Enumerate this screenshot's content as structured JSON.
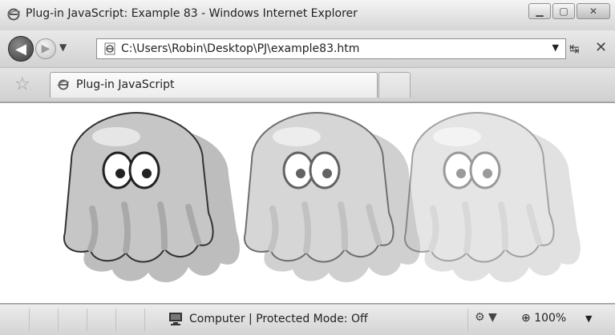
{
  "window": {
    "title": "Plug-in JavaScript: Example 83 - Windows Internet Explorer",
    "controls": {
      "minimize": "▁",
      "maximize": "▢",
      "close": "✕"
    }
  },
  "nav": {
    "back_icon": "back-arrow-icon",
    "forward_icon": "forward-arrow-icon",
    "address": "C:\\Users\\Robin\\Desktop\\PJ\\example83.htm",
    "dropdown_glyph": "▼",
    "refresh_glyph": "↹",
    "stop_glyph": "✕"
  },
  "tabs": [
    {
      "label": "Plug-in JavaScript",
      "active": true
    }
  ],
  "content": {
    "ghosts": [
      {
        "opacity": 1.0
      },
      {
        "opacity": 0.7
      },
      {
        "opacity": 0.45
      }
    ]
  },
  "status": {
    "zone": "Computer | Protected Mode: Off",
    "zoom": "100%"
  },
  "colors": {
    "ghost_body": "#c6c6c6",
    "ghost_shadow": "#bdbdbd",
    "ghost_outline": "#333333"
  }
}
